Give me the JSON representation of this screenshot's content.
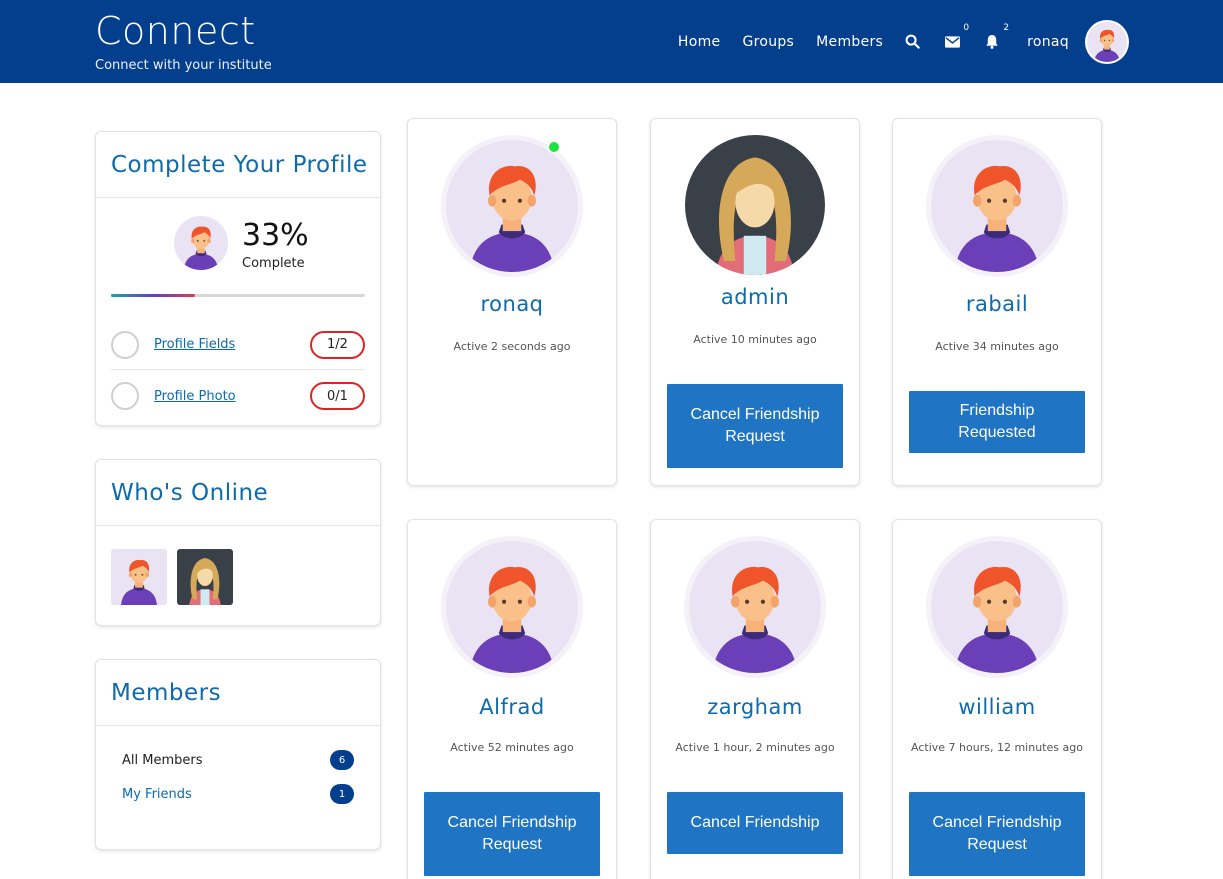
{
  "header": {
    "brand_title": "Connect",
    "brand_subtitle": "Connect with your institute",
    "nav": [
      "Home",
      "Groups",
      "Members"
    ],
    "messages_count": "0",
    "notifications_count": "2",
    "username": "ronaq",
    "bg_color": "#043f8d"
  },
  "profile_completion": {
    "title": "Complete Your Profile",
    "percent_text": "33%",
    "percent_value": 33,
    "complete_label": "Complete",
    "rows": [
      {
        "label": "Profile Fields",
        "value": "1/2"
      },
      {
        "label": "Profile Photo",
        "value": "0/1"
      }
    ]
  },
  "whos_online": {
    "title": "Who's Online",
    "users": [
      "boy-avatar",
      "girl-avatar"
    ]
  },
  "members_widget": {
    "title": "Members",
    "rows": [
      {
        "label": "All Members",
        "count": "6"
      },
      {
        "label": "My Friends",
        "count": "1"
      }
    ]
  },
  "members": [
    {
      "name": "ronaq",
      "active": "Active 2 seconds ago",
      "avatar": "boy-avatar",
      "online": true,
      "button": ""
    },
    {
      "name": "admin",
      "active": "Active 10 minutes ago",
      "avatar": "girl-avatar",
      "online": false,
      "button": "Cancel Friendship Request"
    },
    {
      "name": "rabail",
      "active": "Active 34 minutes ago",
      "avatar": "boy-avatar",
      "online": false,
      "button": "Friendship Requested"
    },
    {
      "name": "Alfrad",
      "active": "Active 52 minutes ago",
      "avatar": "boy-avatar",
      "online": false,
      "button": "Cancel Friendship Request"
    },
    {
      "name": "zargham",
      "active": "Active 1 hour, 2 minutes ago",
      "avatar": "boy-avatar",
      "online": false,
      "button": "Cancel Friendship"
    },
    {
      "name": "william",
      "active": "Active 7 hours, 12 minutes ago",
      "avatar": "boy-avatar",
      "online": false,
      "button": "Cancel Friendship Request"
    }
  ],
  "colors": {
    "accent": "#0d6aab",
    "button": "#1f74c3",
    "online": "#1ee23d",
    "pill_border": "#e02222"
  }
}
